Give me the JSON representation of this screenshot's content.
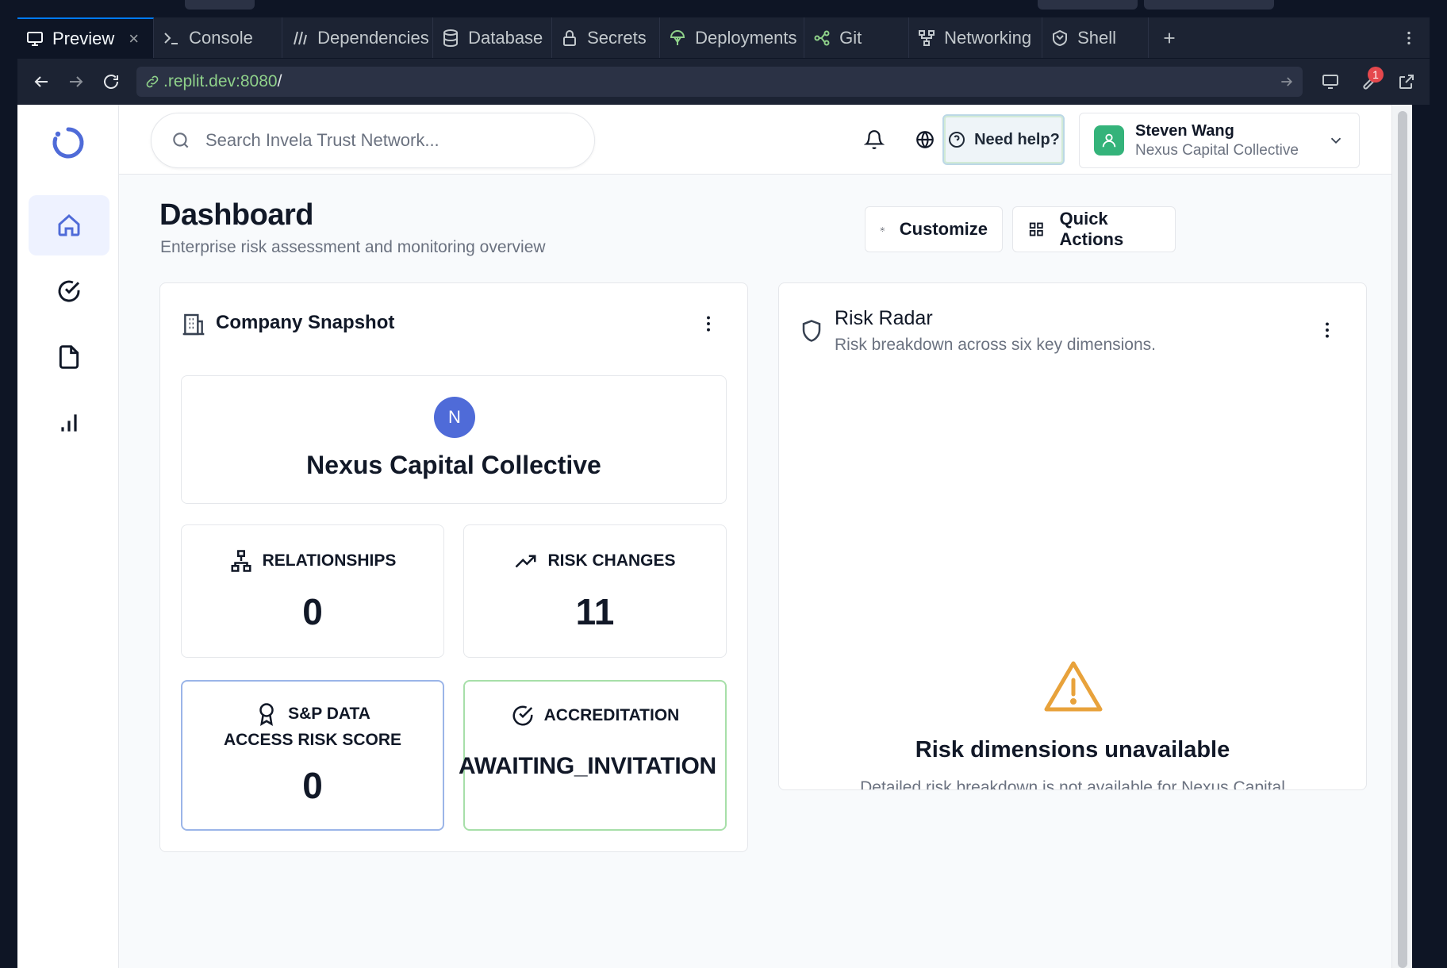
{
  "ide": {
    "tabs": [
      {
        "label": "Preview",
        "icon": "monitor-icon",
        "active": true
      },
      {
        "label": "Console",
        "icon": "terminal-icon"
      },
      {
        "label": "Dependencies",
        "icon": "dependencies-icon"
      },
      {
        "label": "Database",
        "icon": "database-icon"
      },
      {
        "label": "Secrets",
        "icon": "lock-icon"
      },
      {
        "label": "Deployments",
        "icon": "deployments-icon"
      },
      {
        "label": "Git",
        "icon": "git-icon"
      },
      {
        "label": "Networking",
        "icon": "networking-icon"
      },
      {
        "label": "Shell",
        "icon": "shell-icon"
      }
    ],
    "url_host": ".replit.dev:8080",
    "url_path": "/",
    "notification_badge": "1",
    "accent": "#0079f2"
  },
  "app": {
    "search_placeholder": "Search Invela Trust Network...",
    "help_label": "Need help?",
    "user": {
      "name": "Steven Wang",
      "org": "Nexus Capital Collective"
    },
    "sidebar": [
      "home-icon",
      "check-circle-icon",
      "document-icon",
      "chart-icon"
    ],
    "brand_color": "#4f6bd8"
  },
  "dashboard": {
    "title": "Dashboard",
    "subtitle": "Enterprise risk assessment and monitoring overview",
    "customize_label": "Customize",
    "quick_actions_label": "Quick Actions"
  },
  "snapshot": {
    "title": "Company Snapshot",
    "initial": "N",
    "company_name": "Nexus Capital Collective",
    "relationships_label": "RELATIONSHIPS",
    "relationships_value": "0",
    "risk_changes_label": "RISK CHANGES",
    "risk_changes_value": "11",
    "sp_label_line1": "S&P DATA",
    "sp_label_line2": "ACCESS RISK SCORE",
    "sp_value": "0",
    "accreditation_label": "ACCREDITATION",
    "accreditation_value": "AWAITING_INVITATION",
    "sp_border": "#9bb5e8",
    "accreditation_border": "#a7dfa9"
  },
  "radar": {
    "title": "Risk Radar",
    "subtitle": "Risk breakdown across six key dimensions.",
    "unavailable_title": "Risk dimensions unavailable",
    "unavailable_desc": "Detailed risk breakdown is not available for Nexus Capital",
    "warning_color": "#e8a23b"
  }
}
